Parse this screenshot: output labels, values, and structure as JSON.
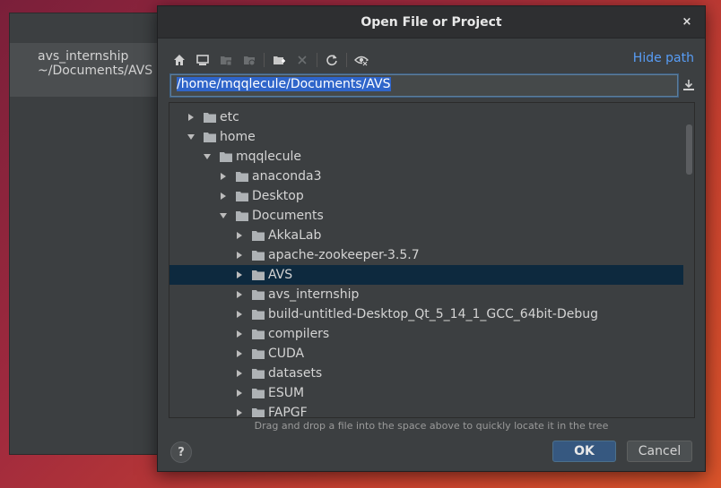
{
  "background_window": {
    "recent_project": {
      "name": "avs_internship",
      "path": "~/Documents/AVS"
    }
  },
  "dialog": {
    "title": "Open File or Project",
    "close_icon": "×",
    "hide_path_label": "Hide path",
    "path_value": "/home/mqqlecule/Documents/AVS",
    "hint": "Drag and drop a file into the space above to quickly locate it in the tree",
    "ok_label": "OK",
    "cancel_label": "Cancel",
    "help_label": "?"
  },
  "toolbar": {
    "icons": [
      "home-icon",
      "desktop-icon",
      "project-folder-icon",
      "module-folder-icon",
      "new-folder-icon",
      "delete-icon",
      "refresh-icon",
      "show-hidden-icon"
    ]
  },
  "tree": {
    "rows": [
      {
        "label": "etc",
        "expanded": false
      },
      {
        "label": "home",
        "expanded": true
      },
      {
        "label": "mqqlecule",
        "expanded": true
      },
      {
        "label": "anaconda3",
        "expanded": false
      },
      {
        "label": "Desktop",
        "expanded": false
      },
      {
        "label": "Documents",
        "expanded": true
      },
      {
        "label": "AkkaLab",
        "expanded": false
      },
      {
        "label": "apache-zookeeper-3.5.7",
        "expanded": false
      },
      {
        "label": "AVS",
        "expanded": false,
        "selected": true
      },
      {
        "label": "avs_internship",
        "expanded": false
      },
      {
        "label": "build-untitled-Desktop_Qt_5_14_1_GCC_64bit-Debug",
        "expanded": false
      },
      {
        "label": "compilers",
        "expanded": false
      },
      {
        "label": "CUDA",
        "expanded": false
      },
      {
        "label": "datasets",
        "expanded": false
      },
      {
        "label": "ESUM",
        "expanded": false
      },
      {
        "label": "FAPGF",
        "expanded": false
      }
    ]
  },
  "colors": {
    "dialog_bg": "#3c3f41",
    "selection": "#0d293e",
    "link": "#589df6",
    "ok_button": "#365880"
  }
}
